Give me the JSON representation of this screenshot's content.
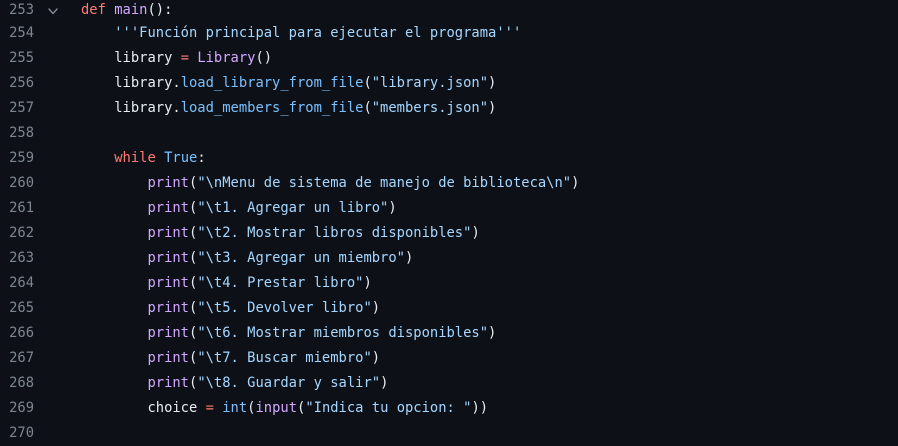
{
  "editor": {
    "lines": [
      {
        "number": "253",
        "foldable": true,
        "tokens": [
          {
            "t": "def",
            "c": "kw"
          },
          {
            "t": " ",
            "c": "plain"
          },
          {
            "t": "main",
            "c": "fn"
          },
          {
            "t": "():",
            "c": "plain"
          }
        ]
      },
      {
        "number": "254",
        "tokens": [
          {
            "t": "    ",
            "c": "plain"
          },
          {
            "t": "'''Función principal para ejecutar el programa'''",
            "c": "str"
          }
        ]
      },
      {
        "number": "255",
        "tokens": [
          {
            "t": "    library ",
            "c": "plain"
          },
          {
            "t": "=",
            "c": "op"
          },
          {
            "t": " ",
            "c": "plain"
          },
          {
            "t": "Library",
            "c": "fn"
          },
          {
            "t": "()",
            "c": "plain"
          }
        ]
      },
      {
        "number": "256",
        "tokens": [
          {
            "t": "    library.",
            "c": "plain"
          },
          {
            "t": "load_library_from_file",
            "c": "const"
          },
          {
            "t": "(",
            "c": "plain"
          },
          {
            "t": "\"library.json\"",
            "c": "str"
          },
          {
            "t": ")",
            "c": "plain"
          }
        ]
      },
      {
        "number": "257",
        "tokens": [
          {
            "t": "    library.",
            "c": "plain"
          },
          {
            "t": "load_members_from_file",
            "c": "const"
          },
          {
            "t": "(",
            "c": "plain"
          },
          {
            "t": "\"members.json\"",
            "c": "str"
          },
          {
            "t": ")",
            "c": "plain"
          }
        ]
      },
      {
        "number": "258",
        "tokens": []
      },
      {
        "number": "259",
        "tokens": [
          {
            "t": "    ",
            "c": "plain"
          },
          {
            "t": "while",
            "c": "kw"
          },
          {
            "t": " ",
            "c": "plain"
          },
          {
            "t": "True",
            "c": "const"
          },
          {
            "t": ":",
            "c": "plain"
          }
        ]
      },
      {
        "number": "260",
        "tokens": [
          {
            "t": "        ",
            "c": "plain"
          },
          {
            "t": "print",
            "c": "fn"
          },
          {
            "t": "(",
            "c": "plain"
          },
          {
            "t": "\"\\nMenu de sistema de manejo de biblioteca\\n\"",
            "c": "str"
          },
          {
            "t": ")",
            "c": "plain"
          }
        ]
      },
      {
        "number": "261",
        "tokens": [
          {
            "t": "        ",
            "c": "plain"
          },
          {
            "t": "print",
            "c": "fn"
          },
          {
            "t": "(",
            "c": "plain"
          },
          {
            "t": "\"\\t1. Agregar un libro\"",
            "c": "str"
          },
          {
            "t": ")",
            "c": "plain"
          }
        ]
      },
      {
        "number": "262",
        "tokens": [
          {
            "t": "        ",
            "c": "plain"
          },
          {
            "t": "print",
            "c": "fn"
          },
          {
            "t": "(",
            "c": "plain"
          },
          {
            "t": "\"\\t2. Mostrar libros disponibles\"",
            "c": "str"
          },
          {
            "t": ")",
            "c": "plain"
          }
        ]
      },
      {
        "number": "263",
        "tokens": [
          {
            "t": "        ",
            "c": "plain"
          },
          {
            "t": "print",
            "c": "fn"
          },
          {
            "t": "(",
            "c": "plain"
          },
          {
            "t": "\"\\t3. Agregar un miembro\"",
            "c": "str"
          },
          {
            "t": ")",
            "c": "plain"
          }
        ]
      },
      {
        "number": "264",
        "tokens": [
          {
            "t": "        ",
            "c": "plain"
          },
          {
            "t": "print",
            "c": "fn"
          },
          {
            "t": "(",
            "c": "plain"
          },
          {
            "t": "\"\\t4. Prestar libro\"",
            "c": "str"
          },
          {
            "t": ")",
            "c": "plain"
          }
        ]
      },
      {
        "number": "265",
        "tokens": [
          {
            "t": "        ",
            "c": "plain"
          },
          {
            "t": "print",
            "c": "fn"
          },
          {
            "t": "(",
            "c": "plain"
          },
          {
            "t": "\"\\t5. Devolver libro\"",
            "c": "str"
          },
          {
            "t": ")",
            "c": "plain"
          }
        ]
      },
      {
        "number": "266",
        "tokens": [
          {
            "t": "        ",
            "c": "plain"
          },
          {
            "t": "print",
            "c": "fn"
          },
          {
            "t": "(",
            "c": "plain"
          },
          {
            "t": "\"\\t6. Mostrar miembros disponibles\"",
            "c": "str"
          },
          {
            "t": ")",
            "c": "plain"
          }
        ]
      },
      {
        "number": "267",
        "tokens": [
          {
            "t": "        ",
            "c": "plain"
          },
          {
            "t": "print",
            "c": "fn"
          },
          {
            "t": "(",
            "c": "plain"
          },
          {
            "t": "\"\\t7. Buscar miembro\"",
            "c": "str"
          },
          {
            "t": ")",
            "c": "plain"
          }
        ]
      },
      {
        "number": "268",
        "tokens": [
          {
            "t": "        ",
            "c": "plain"
          },
          {
            "t": "print",
            "c": "fn"
          },
          {
            "t": "(",
            "c": "plain"
          },
          {
            "t": "\"\\t8. Guardar y salir\"",
            "c": "str"
          },
          {
            "t": ")",
            "c": "plain"
          }
        ]
      },
      {
        "number": "269",
        "tokens": [
          {
            "t": "        choice ",
            "c": "plain"
          },
          {
            "t": "=",
            "c": "op"
          },
          {
            "t": " ",
            "c": "plain"
          },
          {
            "t": "int",
            "c": "const"
          },
          {
            "t": "(",
            "c": "plain"
          },
          {
            "t": "input",
            "c": "fn"
          },
          {
            "t": "(",
            "c": "plain"
          },
          {
            "t": "\"Indica tu opcion: \"",
            "c": "str"
          },
          {
            "t": "))",
            "c": "plain"
          }
        ]
      },
      {
        "number": "270",
        "tokens": []
      }
    ]
  },
  "colors": {
    "background": "#0d1117",
    "line_number": "#7d8590",
    "keyword": "#ff7b72",
    "function": "#d2a8ff",
    "constant": "#79c0ff",
    "string": "#a5d6ff",
    "text": "#e6edf3"
  },
  "icons": {
    "fold": "chevron-down-icon"
  }
}
